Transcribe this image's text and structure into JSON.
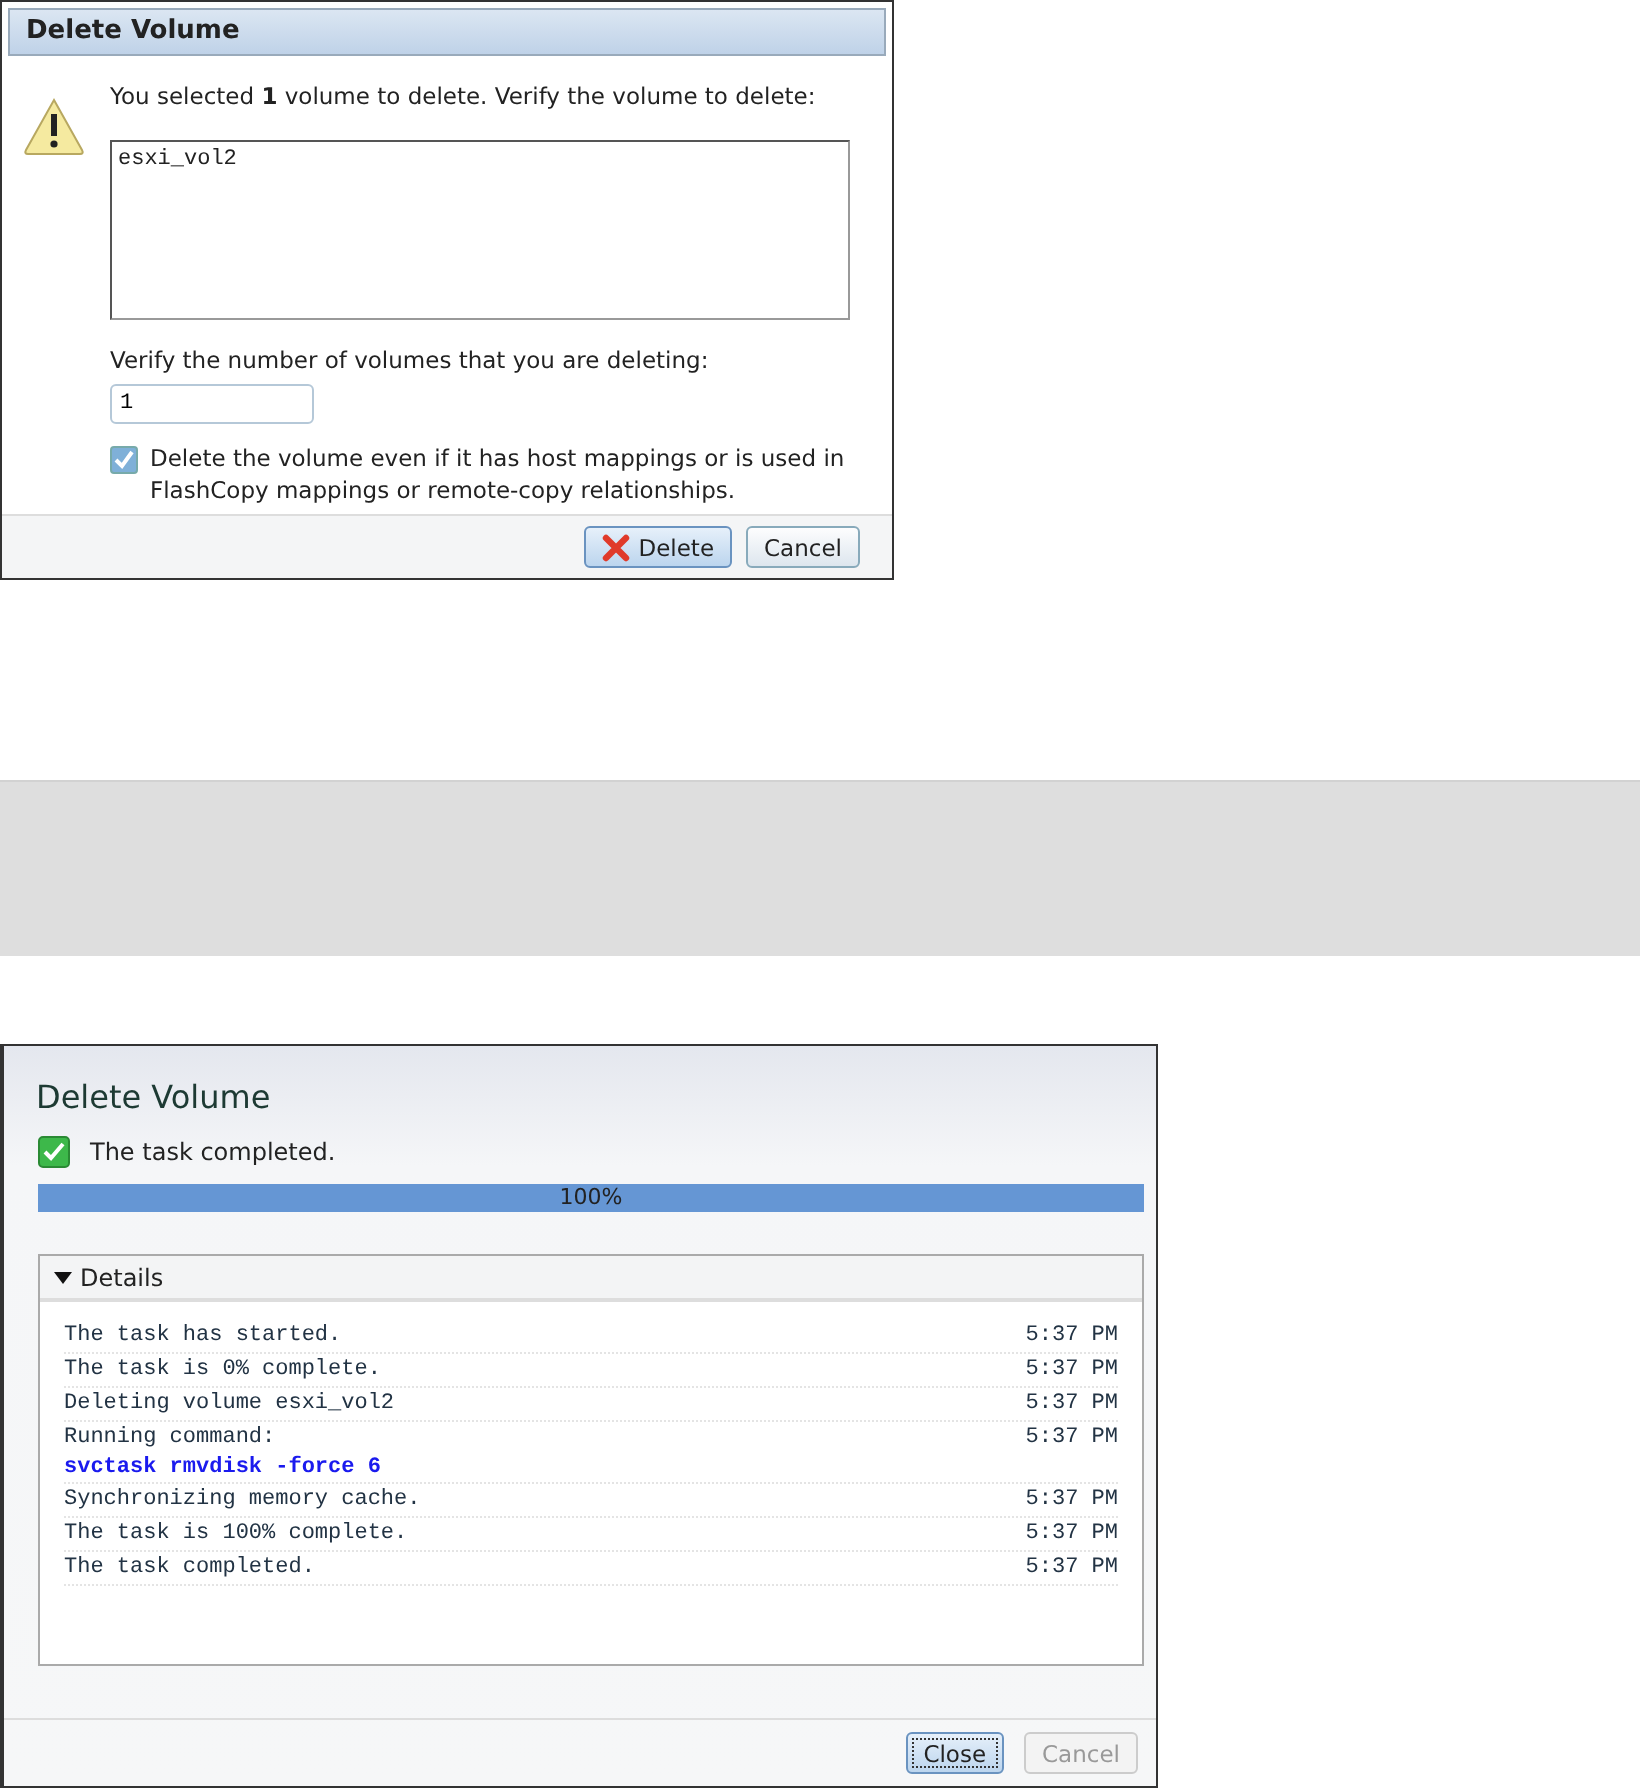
{
  "confirm_dialog": {
    "title": "Delete Volume",
    "message": "You selected **1** volume to delete. Verify the volume to delete:",
    "volume_list": [
      "esxi_vol2"
    ],
    "count_label": "Verify the number of volumes that you are deleting:",
    "count_value": "1",
    "force": {
      "label": "Delete the volume even if it has host mappings or is used in FlashCopy mappings or remote-copy relationships.",
      "checked": true
    },
    "buttons": [
      {
        "label": "Delete",
        "kind": "delete",
        "default": true,
        "disabled": false
      },
      {
        "label": "Cancel",
        "kind": "plain",
        "default": false,
        "disabled": false
      }
    ]
  },
  "progress_dialog": {
    "title": "Delete Volume",
    "status": "The task completed.",
    "progress": {
      "level": 1,
      "reading": "100%"
    },
    "details": {
      "label": "Details",
      "expanded": true,
      "rows": [
        {
          "text": "The task has started.",
          "time": "5:37 PM"
        },
        {
          "text": "The task is 0% complete.",
          "time": "5:37 PM"
        },
        {
          "text": "Deleting volume esxi_vol2",
          "time": "5:37 PM"
        },
        {
          "text": "Running command:",
          "command": "svctask rmvdisk -force 6",
          "time": "5:37 PM"
        },
        {
          "text": "Synchronizing memory cache.",
          "time": "5:37 PM"
        },
        {
          "text": "The task is 100% complete.",
          "time": "5:37 PM"
        },
        {
          "text": "The task completed.",
          "time": "5:37 PM"
        }
      ]
    },
    "buttons": [
      {
        "label": "Close",
        "default": true,
        "disabled": false
      },
      {
        "label": "Cancel",
        "default": false,
        "disabled": true
      }
    ]
  }
}
